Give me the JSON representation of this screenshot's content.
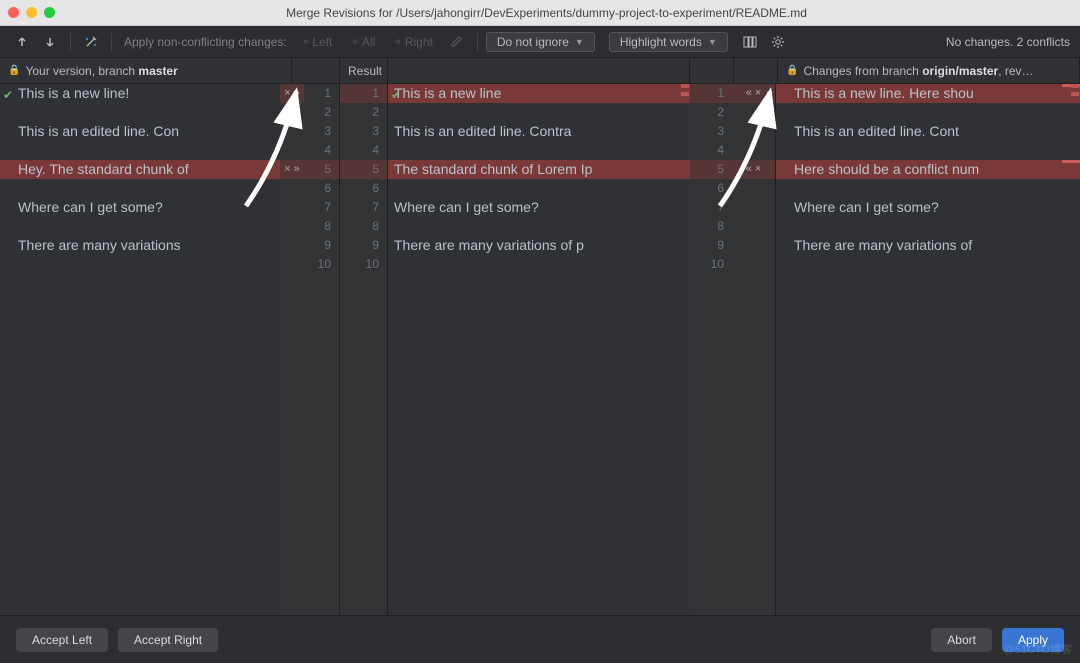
{
  "window": {
    "title": "Merge Revisions for /Users/jahongirr/DevExperiments/dummy-project-to-experiment/README.md"
  },
  "toolbar": {
    "apply_label": "Apply non-conflicting changes:",
    "left": "Left",
    "all": "All",
    "right": "Right",
    "dropdown_ignore": "Do not ignore",
    "dropdown_highlight": "Highlight words",
    "status": "No changes. 2 conflicts"
  },
  "headers": {
    "left_prefix": "Your version, branch ",
    "left_branch": "master",
    "result": "Result",
    "right_prefix": "Changes from branch ",
    "right_branch": "origin/master",
    "right_suffix": ", rev…"
  },
  "content": {
    "left": [
      {
        "n": 1,
        "t": "This is a new line!",
        "hl": "green",
        "check": true,
        "act": "×»"
      },
      {
        "n": 2,
        "t": "",
        "act": ""
      },
      {
        "n": 3,
        "t": "This is an edited line. Con",
        "act": ""
      },
      {
        "n": 4,
        "t": "",
        "act": ""
      },
      {
        "n": 5,
        "t": "Hey. The standard chunk of",
        "hl": "red",
        "act": "×»"
      },
      {
        "n": 6,
        "t": "",
        "act": ""
      },
      {
        "n": 7,
        "t": "Where can I get some?",
        "act": ""
      },
      {
        "n": 8,
        "t": "",
        "act": ""
      },
      {
        "n": 9,
        "t": "There are many variations",
        "act": ""
      },
      {
        "n": 10,
        "t": "",
        "act": ""
      }
    ],
    "mid": [
      {
        "n": 1,
        "t": "This is a new line",
        "hl": "red",
        "check": true
      },
      {
        "n": 2,
        "t": ""
      },
      {
        "n": 3,
        "t": "This is an edited line. Contra"
      },
      {
        "n": 4,
        "t": ""
      },
      {
        "n": 5,
        "t": "The standard chunk of Lorem Ip",
        "hl": "red"
      },
      {
        "n": 6,
        "t": ""
      },
      {
        "n": 7,
        "t": "Where can I get some?"
      },
      {
        "n": 8,
        "t": ""
      },
      {
        "n": 9,
        "t": "There are many variations of p"
      },
      {
        "n": 10,
        "t": ""
      }
    ],
    "right": [
      {
        "n": 1,
        "t": "This is a new line. Here shou",
        "hl": "red",
        "act": "«×",
        "edge": true
      },
      {
        "n": 2,
        "t": "",
        "act": ""
      },
      {
        "n": 3,
        "t": "This is an edited line. Cont",
        "act": ""
      },
      {
        "n": 4,
        "t": "",
        "act": ""
      },
      {
        "n": 5,
        "t": "Here should be a conflict num",
        "hl": "red",
        "act": "«×",
        "edge": true
      },
      {
        "n": 6,
        "t": "",
        "act": ""
      },
      {
        "n": 7,
        "t": "Where can I get some?",
        "act": ""
      },
      {
        "n": 8,
        "t": "",
        "act": ""
      },
      {
        "n": 9,
        "t": "There are many variations of",
        "act": ""
      },
      {
        "n": 10,
        "t": "",
        "act": ""
      }
    ]
  },
  "footer": {
    "accept_left": "Accept Left",
    "accept_right": "Accept Right",
    "abort": "Abort",
    "apply": "Apply"
  },
  "watermark": "@51CTO博客"
}
